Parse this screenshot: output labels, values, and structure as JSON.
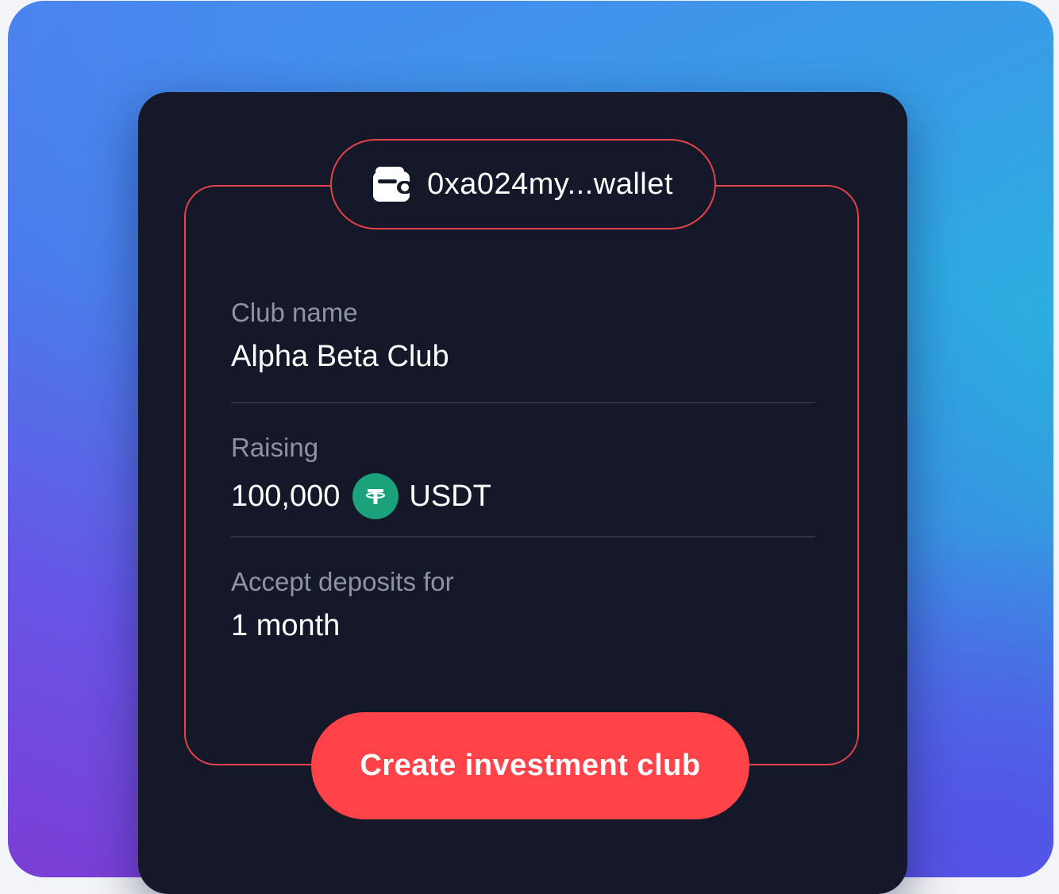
{
  "wallet": {
    "address": "0xa024my...wallet",
    "icon": "wallet-icon"
  },
  "fields": {
    "club_name": {
      "label": "Club name",
      "value": "Alpha Beta Club"
    },
    "raising": {
      "label": "Raising",
      "amount": "100,000",
      "currency": "USDT",
      "currency_icon": "tether-icon",
      "currency_color": "#1ba27a"
    },
    "deposits": {
      "label": "Accept deposits for",
      "value": "1 month"
    }
  },
  "cta": {
    "label": "Create investment club"
  },
  "colors": {
    "accent": "#ff4349",
    "outline": "#e5424a",
    "card": "#141829",
    "label": "#8e93a1"
  }
}
